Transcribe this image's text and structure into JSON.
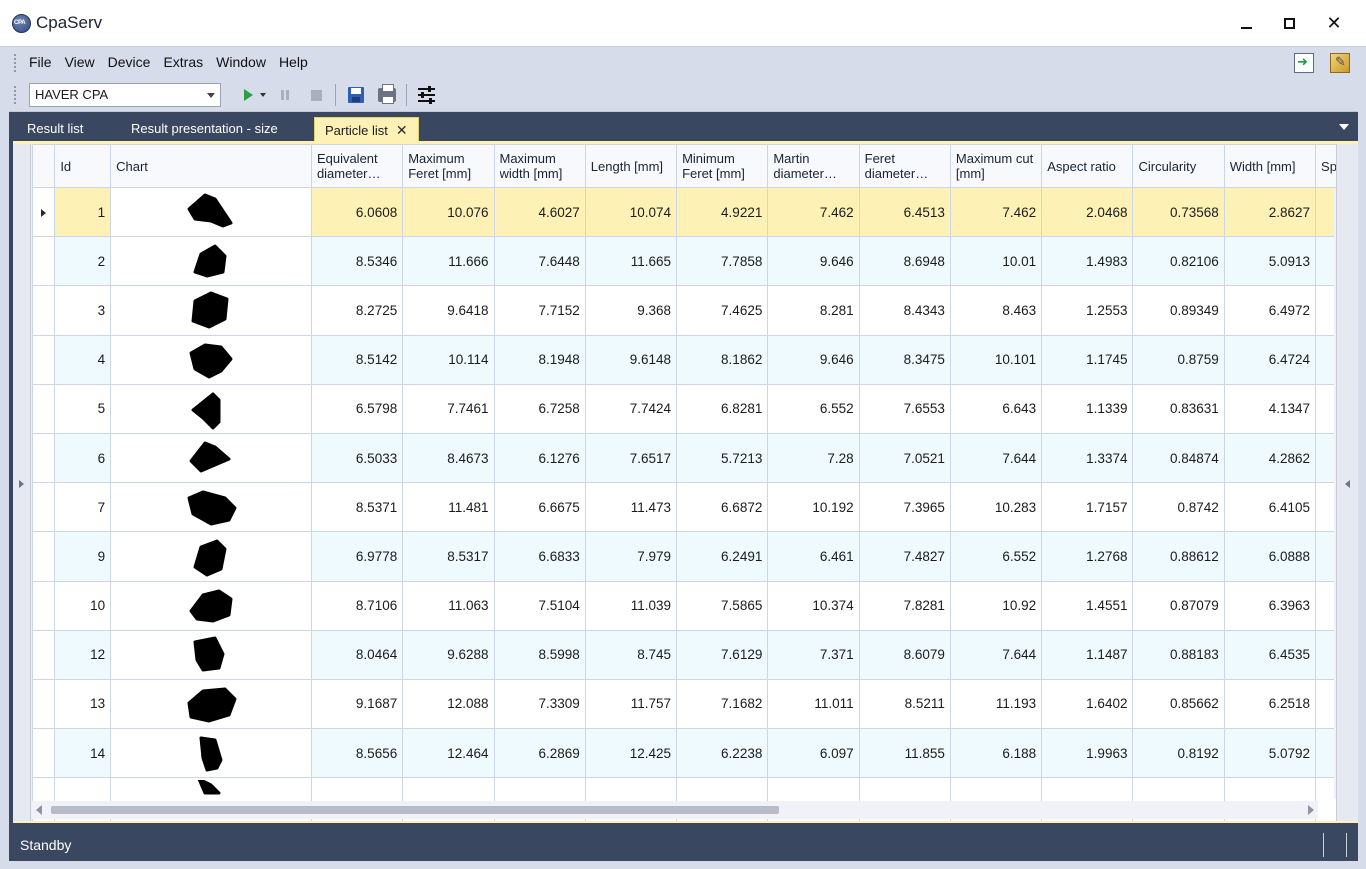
{
  "window": {
    "title": "CpaServ"
  },
  "menu": [
    "File",
    "View",
    "Device",
    "Extras",
    "Window",
    "Help"
  ],
  "toolbar": {
    "device": "HAVER CPA"
  },
  "tabs": [
    {
      "label": "Result list",
      "active": false
    },
    {
      "label": "Result presentation - size",
      "active": false
    },
    {
      "label": "Particle list",
      "active": true
    }
  ],
  "columns": [
    "Id",
    "Chart",
    "Equivalent diameter…",
    "Maximum Feret [mm]",
    "Maximum width [mm]",
    "Length [mm]",
    "Minimum Feret [mm]",
    "Martin diameter…",
    "Feret diameter…",
    "Maximum cut [mm]",
    "Aspect ratio",
    "Circularity",
    "Width [mm]",
    "Sphe"
  ],
  "rows": [
    {
      "id": "1",
      "values": [
        "6.0608",
        "10.076",
        "4.6027",
        "10.074",
        "4.9221",
        "7.462",
        "6.4513",
        "7.462",
        "2.0468",
        "0.73568",
        "2.8627"
      ],
      "selected": true
    },
    {
      "id": "2",
      "values": [
        "8.5346",
        "11.666",
        "7.6448",
        "11.665",
        "7.7858",
        "9.646",
        "8.6948",
        "10.01",
        "1.4983",
        "0.82106",
        "5.0913"
      ]
    },
    {
      "id": "3",
      "values": [
        "8.2725",
        "9.6418",
        "7.7152",
        "9.368",
        "7.4625",
        "8.281",
        "8.4343",
        "8.463",
        "1.2553",
        "0.89349",
        "6.4972"
      ]
    },
    {
      "id": "4",
      "values": [
        "8.5142",
        "10.114",
        "8.1948",
        "9.6148",
        "8.1862",
        "9.646",
        "8.3475",
        "10.101",
        "1.1745",
        "0.8759",
        "6.4724"
      ]
    },
    {
      "id": "5",
      "values": [
        "6.5798",
        "7.7461",
        "6.7258",
        "7.7424",
        "6.8281",
        "6.552",
        "7.6553",
        "6.643",
        "1.1339",
        "0.83631",
        "4.1347"
      ]
    },
    {
      "id": "6",
      "values": [
        "6.5033",
        "8.4673",
        "6.1276",
        "7.6517",
        "5.7213",
        "7.28",
        "7.0521",
        "7.644",
        "1.3374",
        "0.84874",
        "4.2862"
      ]
    },
    {
      "id": "7",
      "values": [
        "8.5371",
        "11.481",
        "6.6675",
        "11.473",
        "6.6872",
        "10.192",
        "7.3965",
        "10.283",
        "1.7157",
        "0.8742",
        "6.4105"
      ]
    },
    {
      "id": "9",
      "values": [
        "6.9778",
        "8.5317",
        "6.6833",
        "7.979",
        "6.2491",
        "6.461",
        "7.4827",
        "6.552",
        "1.2768",
        "0.88612",
        "6.0888"
      ]
    },
    {
      "id": "10",
      "values": [
        "8.7106",
        "11.063",
        "7.5104",
        "11.039",
        "7.5865",
        "10.374",
        "7.8281",
        "10.92",
        "1.4551",
        "0.87079",
        "6.3963"
      ]
    },
    {
      "id": "12",
      "values": [
        "8.0464",
        "9.6288",
        "8.5998",
        "8.745",
        "7.6129",
        "7.371",
        "8.6079",
        "7.644",
        "1.1487",
        "0.88183",
        "6.4535"
      ]
    },
    {
      "id": "13",
      "values": [
        "9.1687",
        "12.088",
        "7.3309",
        "11.757",
        "7.1682",
        "11.011",
        "8.5211",
        "11.193",
        "1.6402",
        "0.85662",
        "6.2518"
      ]
    },
    {
      "id": "14",
      "values": [
        "8.5656",
        "12.464",
        "6.2869",
        "12.425",
        "6.2238",
        "6.097",
        "11.855",
        "6.188",
        "1.9963",
        "0.8192",
        "5.0792"
      ]
    },
    {
      "id": "",
      "values": [
        "",
        "",
        "",
        "",
        "",
        "",
        "",
        "",
        "",
        "",
        ""
      ]
    }
  ],
  "status": {
    "text": "Standby"
  },
  "colors": {
    "frame": "#3a4761",
    "active_tab": "#fdf1b6",
    "row_alt": "#eefafe",
    "row_selected": "#fdf1b6"
  },
  "icons": [
    "app-logo-icon",
    "minimize-icon",
    "maximize-icon",
    "close-icon",
    "login-icon",
    "settings-icon",
    "play-icon",
    "pause-icon",
    "stop-icon",
    "save-icon",
    "print-icon",
    "filter-settings-icon",
    "tab-close-icon"
  ]
}
